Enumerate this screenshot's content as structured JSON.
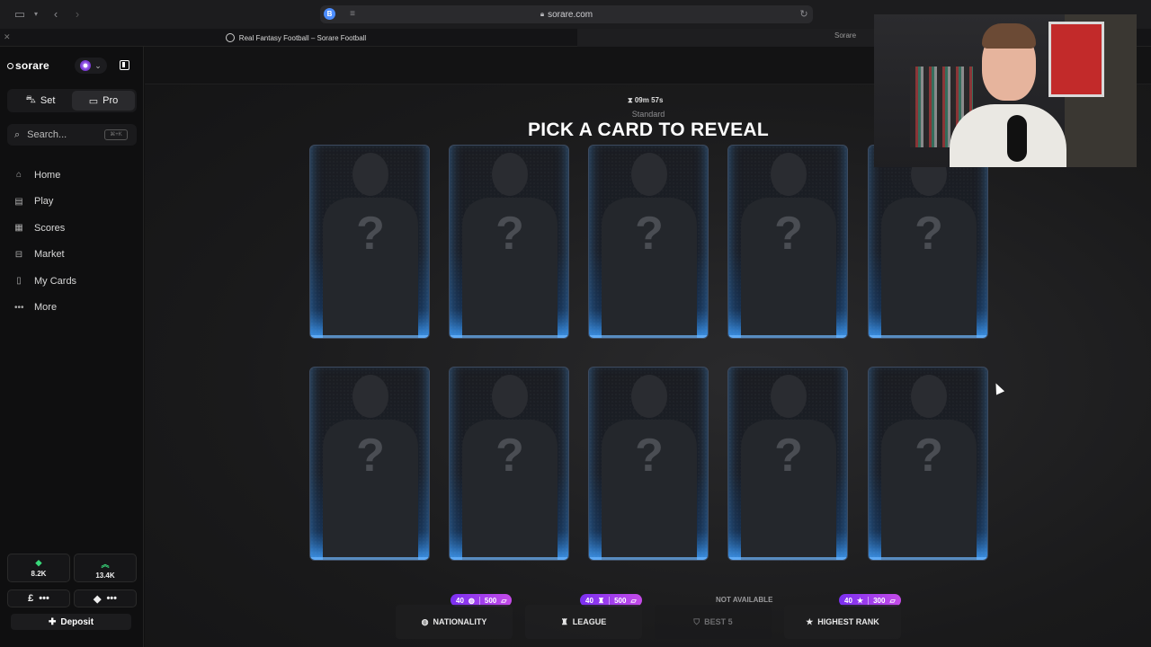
{
  "browser": {
    "url": "sorare.com",
    "tab_title": "Real Fantasy Football – Sorare Football",
    "second_tab_title": "Sorare",
    "badge_letter": "B"
  },
  "sidebar": {
    "logo": "sorare",
    "mode_set": "Set",
    "mode_pro": "Pro",
    "search_placeholder": "Search...",
    "search_shortcut": "⌘+K",
    "nav": [
      {
        "label": "Home",
        "icon": "home-icon"
      },
      {
        "label": "Play",
        "icon": "play-icon"
      },
      {
        "label": "Scores",
        "icon": "scores-icon"
      },
      {
        "label": "Market",
        "icon": "market-icon"
      },
      {
        "label": "My Cards",
        "icon": "cards-icon"
      },
      {
        "label": "More",
        "icon": "more-icon"
      }
    ],
    "stats": [
      {
        "value": "8.2K",
        "icon": "gem-icon"
      },
      {
        "value": "13.4K",
        "icon": "chevrons-up-icon"
      }
    ],
    "wallets": [
      {
        "symbol": "£",
        "value": "•••"
      },
      {
        "symbol": "◆",
        "value": "•••"
      }
    ],
    "deposit_label": "Deposit"
  },
  "main": {
    "timer": "09m 57s",
    "subtitle": "Standard",
    "title": "PICK A CARD TO REVEAL",
    "cards": [
      {
        "label": "?"
      },
      {
        "label": "?"
      },
      {
        "label": "?"
      },
      {
        "label": "?"
      },
      {
        "label": "?"
      },
      {
        "label": "?"
      },
      {
        "label": "?"
      },
      {
        "label": "?"
      },
      {
        "label": "?"
      },
      {
        "label": "?"
      }
    ],
    "filters": [
      {
        "label": "NATIONALITY",
        "icon": "globe-icon",
        "pill_left": "40",
        "pill_right": "500",
        "available": true
      },
      {
        "label": "LEAGUE",
        "icon": "trophy-icon",
        "pill_left": "40",
        "pill_right": "500",
        "available": true
      },
      {
        "label": "BEST 5",
        "icon": "shield-icon",
        "pill_left": "",
        "pill_right": "",
        "available": false,
        "status": "NOT AVAILABLE"
      },
      {
        "label": "HIGHEST RANK",
        "icon": "star-icon",
        "pill_left": "40",
        "pill_right": "300",
        "available": true
      }
    ]
  },
  "colors": {
    "accent_purple": "#8b3cf0",
    "card_glow": "#2a78c8",
    "positive_green": "#39d97a"
  }
}
